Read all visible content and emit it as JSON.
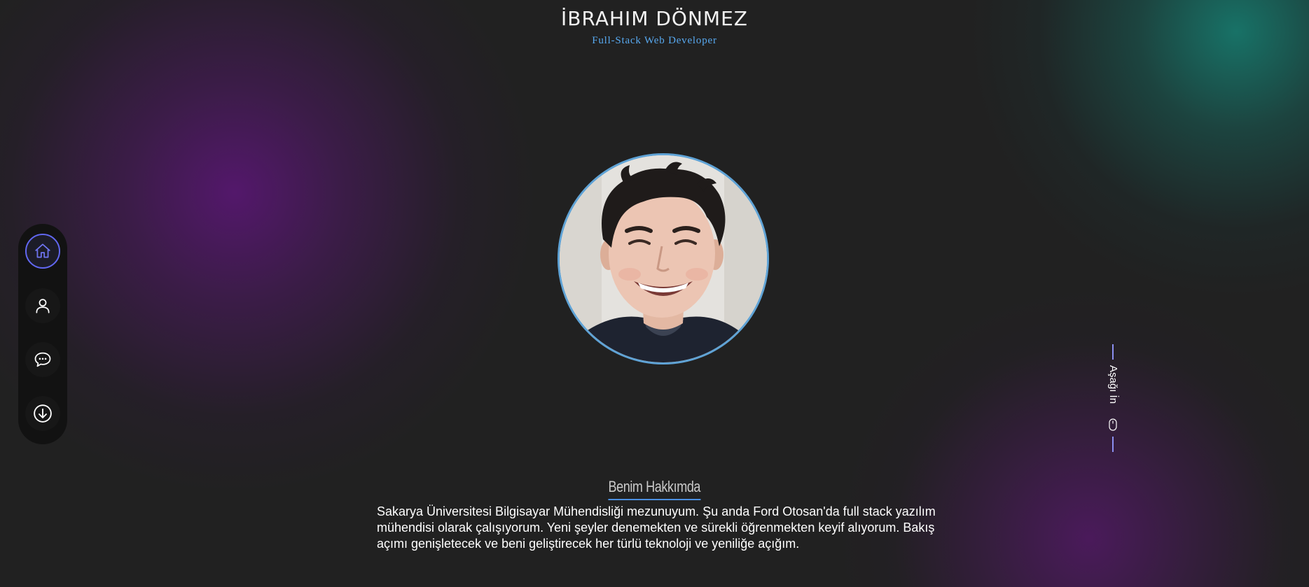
{
  "header": {
    "name": "İBRAHIM DÖNMEZ",
    "subtitle": "Full-Stack Web Developer"
  },
  "profile": {
    "photo_alt": "profile-photo"
  },
  "sidenav": {
    "items": [
      {
        "icon": "home-icon",
        "active": true
      },
      {
        "icon": "user-icon",
        "active": false
      },
      {
        "icon": "chat-icon",
        "active": false
      },
      {
        "icon": "download-icon",
        "active": false
      }
    ]
  },
  "scroll": {
    "label": "Aşağı İn",
    "icon": "mouse-icon"
  },
  "about": {
    "title": "Benim Hakkımda",
    "text": "Sakarya Üniversitesi Bilgisayar Mühendisliği mezunuyum. Şu anda Ford Otosan'da full stack yazılım mühendisi olarak çalışıyorum. Yeni şeyler denemekten ve sürekli öğrenmekten keyif alıyorum. Bakış açımı genişletecek ve beni geliştirecek her türlü teknoloji ve yeniliğe açığım."
  },
  "colors": {
    "background": "#212121",
    "accent_blue": "#58a9f0",
    "accent_indigo": "#6167f0",
    "glow_purple": "#5c1678",
    "glow_teal": "#168073"
  }
}
